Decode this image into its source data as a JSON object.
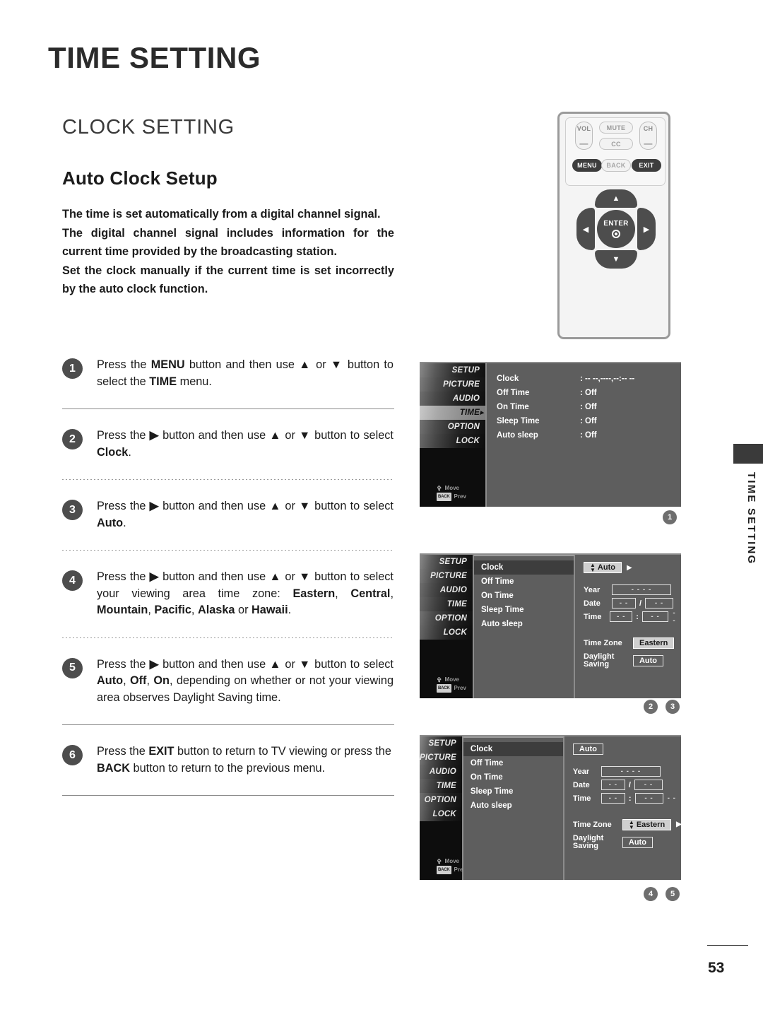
{
  "header": {
    "chapter_title": "TIME SETTING",
    "section_title": "CLOCK SETTING",
    "subsection_title": "Auto Clock Setup"
  },
  "intro": {
    "p1": "The time is set automatically from a digital channel signal.",
    "p2": "The digital channel signal includes information for the current time provided by the broadcasting station.",
    "p3": "Set the clock manually if the current time is set incorrectly by the auto clock function."
  },
  "steps": [
    {
      "number": "1",
      "text_html": "Press the <b>MENU</b> button and then use <b>▲</b> or <b>▼</b> button to select the <b>TIME</b> menu."
    },
    {
      "number": "2",
      "text_html": "Press the <b>▶</b> button and then use <b>▲</b> or <b>▼</b> button to select <b>Clock</b>."
    },
    {
      "number": "3",
      "text_html": "Press the <b>▶</b> button and then use <b>▲</b> or <b>▼</b> button to select <b>Auto</b>."
    },
    {
      "number": "4",
      "text_html": "Press the <b>▶</b> button and then use <b>▲</b> or <b>▼</b> button to select your viewing area time zone: <b>Eastern</b>, <b>Central</b>, <b>Mountain</b>, <b>Pacific</b>, <b>Alaska</b> or <b>Hawaii</b>."
    },
    {
      "number": "5",
      "text_html": "Press the <b>▶</b> button and then use <b>▲</b> or <b>▼</b> button to select <b>Auto</b>, <b>Off</b>, <b>On</b>, depending on whether or not your viewing area observes Daylight Saving time."
    },
    {
      "number": "6",
      "text_html": "Press the <b>EXIT</b> button to return to TV viewing or press the <b>BACK</b> button to return to the previous menu."
    }
  ],
  "remote": {
    "vol_label": "VOL",
    "vol_minus": "—",
    "ch_label": "CH",
    "ch_minus": "—",
    "mute_label": "MUTE",
    "cc_label": "CC",
    "menu_label": "MENU",
    "back_label": "BACK",
    "exit_label": "EXIT",
    "enter_label": "ENTER",
    "up_glyph": "▲",
    "down_glyph": "▼",
    "left_glyph": "◀",
    "right_glyph": "▶"
  },
  "osd": {
    "menu_items": [
      "SETUP",
      "PICTURE",
      "AUDIO",
      "TIME",
      "OPTION",
      "LOCK"
    ],
    "hint_move": "Move",
    "hint_prev": "Prev",
    "hint_prev_key": "BACK",
    "panel1": {
      "rows": [
        {
          "label": "Clock",
          "value": ": -- --,----,--:-- --"
        },
        {
          "label": "Off Time",
          "value": ": Off"
        },
        {
          "label": "On Time",
          "value": ": Off"
        },
        {
          "label": "Sleep Time",
          "value": ": Off"
        },
        {
          "label": "Auto sleep",
          "value": ": Off"
        }
      ],
      "selected_menu": "TIME"
    },
    "panel2": {
      "list": [
        "Clock",
        "Off Time",
        "On Time",
        "Sleep Time",
        "Auto sleep"
      ],
      "selected_list_item": "Clock",
      "mode_chip": "Auto",
      "mode_chip_has_spinner": true,
      "mode_chip_arrow": "▶",
      "year_label": "Year",
      "year_value": "- - - -",
      "date_label": "Date",
      "date_value_1": "- -",
      "date_sep": "/",
      "date_value_2": "- -",
      "time_label": "Time",
      "time_value_1": "- -",
      "time_sep": ":",
      "time_value_2": "- -",
      "time_suffix": "- -",
      "timezone_label": "Time Zone",
      "timezone_value": "Eastern",
      "daylight_label_1": "Daylight",
      "daylight_label_2": "Saving",
      "daylight_value": "Auto"
    },
    "panel3": {
      "list": [
        "Clock",
        "Off Time",
        "On Time",
        "Sleep Time",
        "Auto sleep"
      ],
      "selected_list_item": "Clock",
      "mode_chip": "Auto",
      "year_label": "Year",
      "year_value": "- - - -",
      "date_label": "Date",
      "date_value_1": "- -",
      "date_sep": "/",
      "date_value_2": "- -",
      "time_label": "Time",
      "time_value_1": "- -",
      "time_sep": ":",
      "time_value_2": "- -",
      "time_suffix": "- -",
      "timezone_label": "Time Zone",
      "timezone_value": "Eastern",
      "timezone_has_spinner": true,
      "timezone_arrow": "▶",
      "daylight_label_1": "Daylight",
      "daylight_label_2": "Saving",
      "daylight_value": "Auto"
    }
  },
  "callouts": {
    "group1": [
      "1"
    ],
    "group2": [
      "2",
      "3"
    ],
    "group3": [
      "4",
      "5"
    ]
  },
  "side_tab_label": "TIME SETTING",
  "page_number": "53",
  "colors": {
    "text": "#231f20",
    "badge": "#4d4d4d",
    "osd_background": "#5e5e5e",
    "osd_sidebar": "#0d0d0d",
    "selected_row": "#3d3d3d"
  }
}
